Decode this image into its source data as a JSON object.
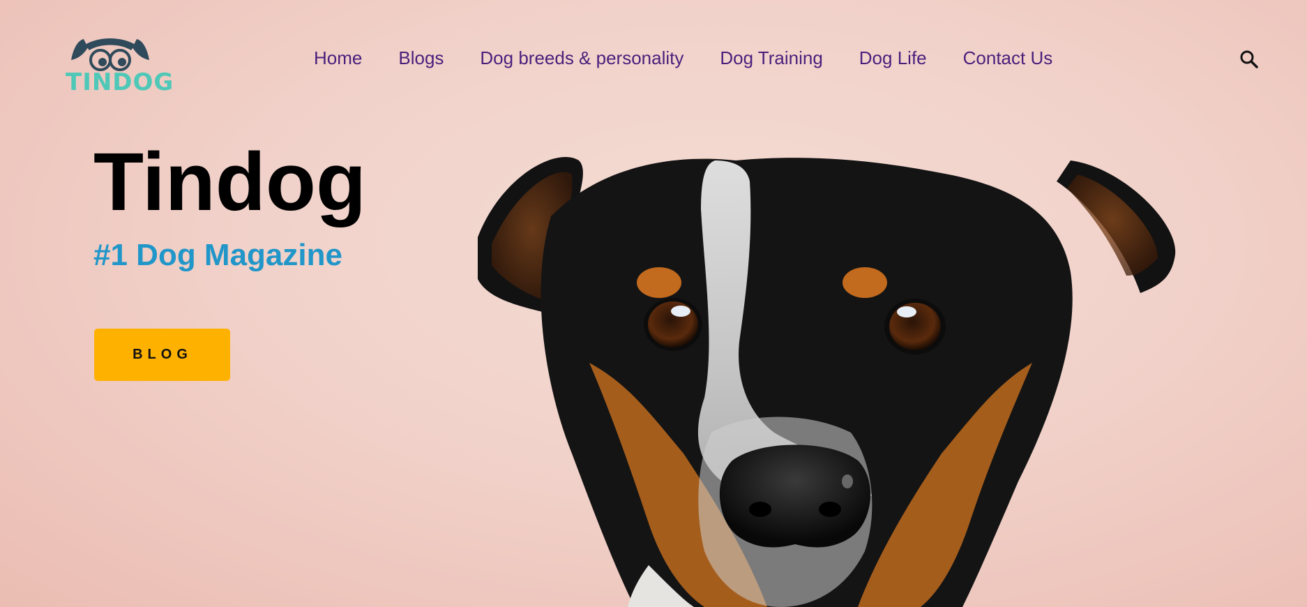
{
  "brand": {
    "logo_text": "TINDOG",
    "logo_icon": "dog-with-glasses-icon",
    "logo_color": "#4fc8b8"
  },
  "nav": {
    "items": [
      {
        "label": "Home"
      },
      {
        "label": "Blogs"
      },
      {
        "label": "Dog breeds & personality"
      },
      {
        "label": "Dog Training"
      },
      {
        "label": "Dog Life"
      },
      {
        "label": "Contact Us"
      }
    ],
    "color": "#4a1f7c",
    "search_icon": "search-icon"
  },
  "hero": {
    "title": "Tindog",
    "subtitle": "#1 Dog Magazine",
    "subtitle_color": "#2196c9",
    "cta_label": "BLOG",
    "cta_color": "#ffb100",
    "image": "dog-face-photo"
  }
}
